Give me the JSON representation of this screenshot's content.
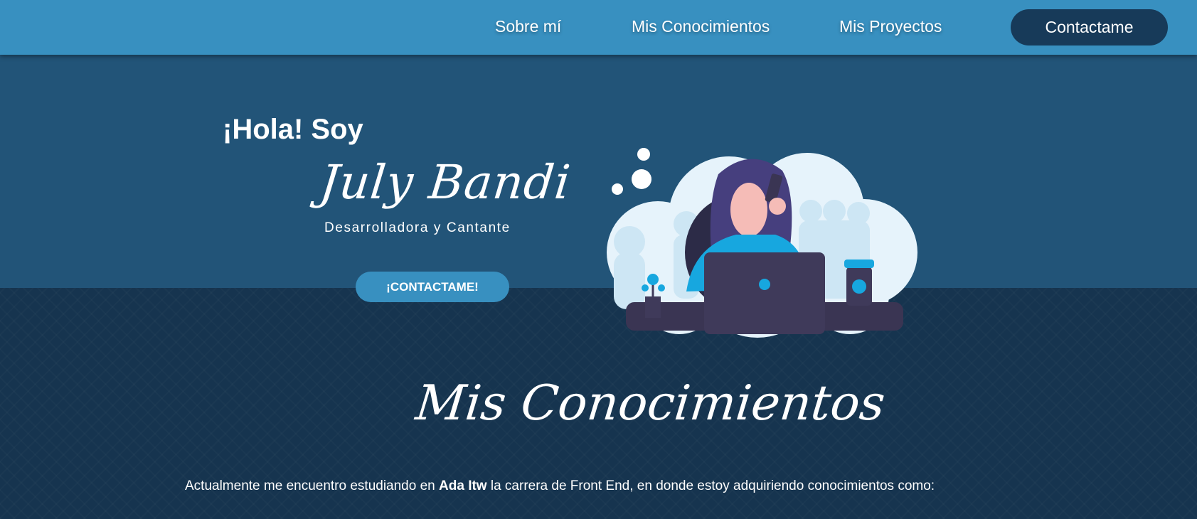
{
  "nav": {
    "items": [
      {
        "label": "Sobre mí"
      },
      {
        "label": "Mis Conocimientos"
      },
      {
        "label": "Mis Proyectos"
      }
    ],
    "contact_label": "Contactame"
  },
  "hero": {
    "greeting": "¡Hola! Soy",
    "name": "July Bandi",
    "subtitle": "Desarrolladora y Cantante",
    "cta_label": "¡CONTACTAME!",
    "illustration": "woman-at-laptop-on-phone"
  },
  "knowledge": {
    "title": "Mis Conocimientos",
    "intro_prefix": "Actualmente me encuentro estudiando en ",
    "intro_bold": "Ada Itw",
    "intro_suffix": " la carrera de Front End, en donde estoy adquiriendo conocimientos como:"
  },
  "colors": {
    "nav_bg": "#3890c0",
    "hero_bg": "#225478",
    "section_bg": "#16344f",
    "button_dark": "#173a59",
    "accent_cyan": "#17a7df"
  }
}
